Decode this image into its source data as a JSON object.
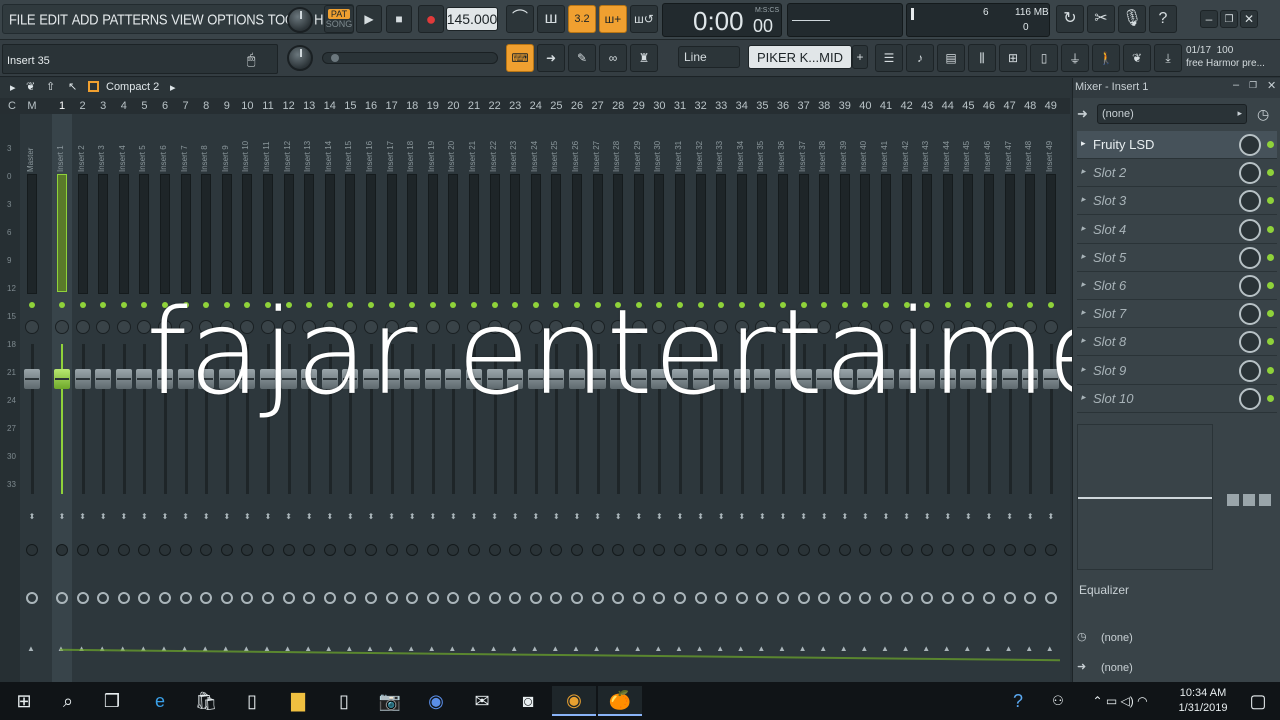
{
  "menu": [
    "FILE",
    "EDIT",
    "ADD",
    "PATTERNS",
    "VIEW",
    "OPTIONS",
    "TOOLS",
    "HELP"
  ],
  "transport": {
    "pat_label": "PAT",
    "song_label": "SONG",
    "tempo": "145.000",
    "time": "0:00",
    "time_sub": "00",
    "time_unit": "M:S:CS"
  },
  "status": {
    "cpu": "6",
    "ram": "116 MB",
    "voices": "0"
  },
  "hint_bar": {
    "text": "Insert 35"
  },
  "snap": {
    "value": "Line"
  },
  "pattern": {
    "name": "PIKER K...MID"
  },
  "news": {
    "counter": "01/17",
    "count2": "100",
    "text": "free Harmor pre..."
  },
  "mixer_header": {
    "view": "Compact 2"
  },
  "columns": [
    "C",
    "M",
    "1",
    "2",
    "3",
    "4",
    "5",
    "6",
    "7",
    "8",
    "9",
    "10",
    "11",
    "12",
    "13",
    "14",
    "15",
    "16",
    "17",
    "18",
    "19",
    "20",
    "21",
    "22",
    "23",
    "24",
    "25",
    "26",
    "27",
    "28",
    "29",
    "30",
    "31",
    "32",
    "33",
    "34",
    "35",
    "36",
    "37",
    "38",
    "39",
    "40",
    "41",
    "42",
    "43",
    "44",
    "45",
    "46",
    "47",
    "48",
    "49"
  ],
  "strips": [
    "Master",
    "Insert 1",
    "Insert 2",
    "Insert 3",
    "Insert 4",
    "Insert 5",
    "Insert 6",
    "Insert 7",
    "Insert 8",
    "Insert 9",
    "Insert 10",
    "Insert 11",
    "Insert 12",
    "Insert 13",
    "Insert 14",
    "Insert 15",
    "Insert 16",
    "Insert 17",
    "Insert 18",
    "Insert 19",
    "Insert 20",
    "Insert 21",
    "Insert 22",
    "Insert 23",
    "Insert 24",
    "Insert 25",
    "Insert 26",
    "Insert 27",
    "Insert 28",
    "Insert 29",
    "Insert 30",
    "Insert 31",
    "Insert 32",
    "Insert 33",
    "Insert 34",
    "Insert 35",
    "Insert 36",
    "Insert 37",
    "Insert 38",
    "Insert 39",
    "Insert 40",
    "Insert 41",
    "Insert 42",
    "Insert 43",
    "Insert 44",
    "Insert 45",
    "Insert 46",
    "Insert 47",
    "Insert 48",
    "Insert 49"
  ],
  "db_scale": [
    "3",
    "0",
    "3",
    "6",
    "9",
    "12",
    "15",
    "18",
    "21",
    "24",
    "27",
    "30",
    "33"
  ],
  "overlay_text": "fajar entertaiment",
  "right_panel": {
    "title": "Mixer - Insert 1",
    "input": "(none)",
    "slots": [
      "Fruity LSD",
      "Slot 2",
      "Slot 3",
      "Slot 4",
      "Slot 5",
      "Slot 6",
      "Slot 7",
      "Slot 8",
      "Slot 9",
      "Slot 10"
    ],
    "eq_label": "Equalizer",
    "output1": "(none)",
    "output2": "(none)"
  },
  "taskbar": {
    "time": "10:34 AM",
    "date": "1/31/2019"
  },
  "colors": {
    "accent_green": "#8fd23a",
    "accent_orange": "#f0a030",
    "bg": "#2d373c"
  }
}
